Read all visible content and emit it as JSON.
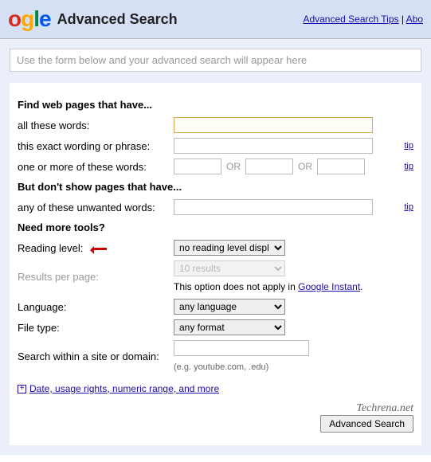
{
  "header": {
    "logo": {
      "part1": "o",
      "part2": "g",
      "part3": "l",
      "part4": "e"
    },
    "title": "Advanced Search",
    "links": {
      "tips": "Advanced Search Tips",
      "about": "Abo",
      "sep": " | "
    }
  },
  "preview": "Use the form below and your advanced search will appear here",
  "find": {
    "heading": "Find web pages that have...",
    "all": "all these words:",
    "exact": "this exact wording or phrase:",
    "any": "one or more of these words:",
    "or": "OR",
    "tip": "tip"
  },
  "exclude": {
    "heading": "But don't show pages that have...",
    "unwanted": "any of these unwanted words:"
  },
  "tools": {
    "heading": "Need more tools?",
    "reading": "Reading level:",
    "reading_sel": "no reading level displ",
    "rpp": "Results per page:",
    "rpp_sel": "10 results",
    "instant1": "This option does not apply in ",
    "instant_link": "Google Instant",
    "instant2": ".",
    "language": "Language:",
    "language_sel": "any language",
    "filetype": "File type:",
    "filetype_sel": "any format",
    "site": "Search within a site or domain:",
    "site_hint": "(e.g. youtube.com, .edu)"
  },
  "expand": "Date, usage rights, numeric range, and more",
  "watermark": "Techrena.net",
  "submit": "Advanced Search"
}
